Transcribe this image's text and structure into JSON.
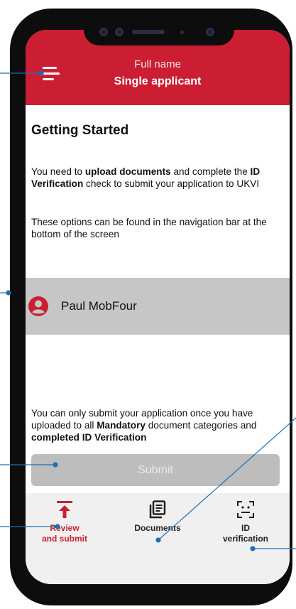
{
  "header": {
    "subtitle": "Full name",
    "title": "Single applicant"
  },
  "content": {
    "heading": "Getting Started",
    "intro": {
      "p1": "You need to ",
      "b1": "upload documents",
      "p2": " and complete the ",
      "b2": "ID Verification",
      "p3": " check to submit your application to UKVI"
    },
    "nav_hint": "These options can be found in the navigation bar at the bottom of the screen",
    "applicant_name": "Paul MobFour",
    "submit_note": {
      "p1": "You can only submit your application once you have uploaded to all ",
      "b1": "Mandatory",
      "p2": " document categories and ",
      "b2": "completed ID Verification"
    },
    "submit_label": "Submit"
  },
  "bottom_nav": {
    "items": [
      {
        "label_line1": "Review",
        "label_line2": "and submit",
        "icon": "upload-icon",
        "active": true
      },
      {
        "label_line1": "Documents",
        "icon": "documents-icon",
        "active": false
      },
      {
        "label_line1": "ID",
        "label_line2": "verification",
        "icon": "face-scan-icon",
        "active": false
      }
    ]
  },
  "colors": {
    "brand_red": "#cc1e33",
    "annotation_blue": "#1f6fb2",
    "disabled_gray": "#bdbdbd"
  }
}
